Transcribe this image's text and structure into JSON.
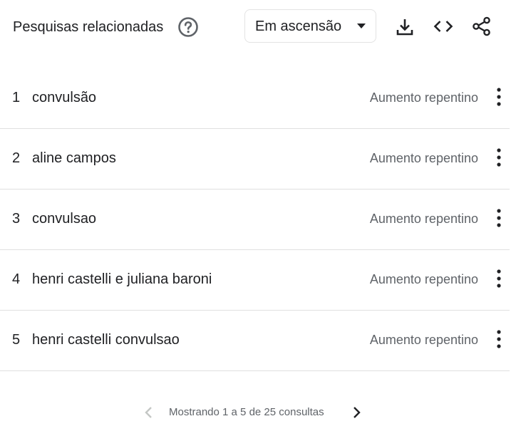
{
  "header": {
    "title": "Pesquisas relacionadas",
    "help_icon": "help-circle-icon",
    "dropdown": {
      "selected": "Em ascensão",
      "icon": "arrow-drop-down-icon"
    },
    "actions": [
      {
        "icon": "download-icon"
      },
      {
        "icon": "embed-code-icon"
      },
      {
        "icon": "share-icon"
      }
    ]
  },
  "queries": [
    {
      "rank": "1",
      "query": "convulsão",
      "value": "Aumento repentino"
    },
    {
      "rank": "2",
      "query": "aline campos",
      "value": "Aumento repentino"
    },
    {
      "rank": "3",
      "query": "convulsao",
      "value": "Aumento repentino"
    },
    {
      "rank": "4",
      "query": "henri castelli e juliana baroni",
      "value": "Aumento repentino"
    },
    {
      "rank": "5",
      "query": "henri castelli convulsao",
      "value": "Aumento repentino"
    }
  ],
  "pagination": {
    "text": "Mostrando 1 a 5 de 25 consultas",
    "prev_icon": "chevron-left-icon",
    "next_icon": "chevron-right-icon"
  },
  "colors": {
    "text_primary": "#202124",
    "text_secondary": "#5f6368",
    "icon": "#5f6368",
    "disabled": "#c4c7c5",
    "divider": "#e0e0e0"
  }
}
